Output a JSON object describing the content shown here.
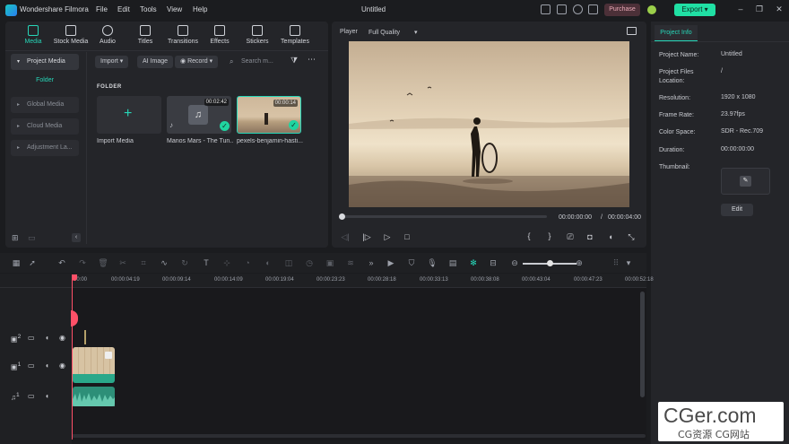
{
  "titlebar": {
    "app_name": "Wondershare Filmora",
    "menu": [
      "File",
      "Edit",
      "Tools",
      "View",
      "Help"
    ],
    "title": "Untitled",
    "purchase_label": "Purchase",
    "export_label": "Export"
  },
  "media_tabs": [
    {
      "label": "Media",
      "icon": "media-icon",
      "active": true
    },
    {
      "label": "Stock Media",
      "icon": "stock-media-icon"
    },
    {
      "label": "Audio",
      "icon": "music-note-icon"
    },
    {
      "label": "Titles",
      "icon": "text-t-icon"
    },
    {
      "label": "Transitions",
      "icon": "transition-icon"
    },
    {
      "label": "Effects",
      "icon": "sparkle-icon"
    },
    {
      "label": "Stickers",
      "icon": "sticker-icon"
    },
    {
      "label": "Templates",
      "icon": "template-icon"
    }
  ],
  "sidebar": {
    "project_media": "Project Media",
    "folder": "Folder",
    "items": [
      "Global Media",
      "Cloud Media",
      "Adjustment La..."
    ]
  },
  "media_toolbar": {
    "import": "Import",
    "ai_image": "AI Image",
    "record": "Record",
    "search_placeholder": "Search m..."
  },
  "media_grid": {
    "folder_label": "FOLDER",
    "import_label": "Import Media",
    "items": [
      {
        "name": "Manos Mars - The Tun...",
        "duration": "00:02:42"
      },
      {
        "name": "pexels-benjamin-hasti...",
        "duration": "00:00:14"
      }
    ]
  },
  "player": {
    "label": "Player",
    "quality": "Full Quality",
    "current_time": "00:00:00:00",
    "separator": "/",
    "total_time": "00:00:04:00"
  },
  "project_info": {
    "tab": "Project Info",
    "fields": [
      {
        "label": "Project Name:",
        "value": "Untitled"
      },
      {
        "label": "Project Files Location:",
        "value": "/"
      },
      {
        "label": "Resolution:",
        "value": "1920 x 1080"
      },
      {
        "label": "Frame Rate:",
        "value": "23.97fps"
      },
      {
        "label": "Color Space:",
        "value": "SDR - Rec.709"
      },
      {
        "label": "Duration:",
        "value": "00:00:00:00"
      },
      {
        "label": "Thumbnail:",
        "value": ""
      }
    ],
    "edit_label": "Edit"
  },
  "timeline": {
    "ruler": [
      "00:00",
      "00:00:04:19",
      "00:00:09:14",
      "00:00:14:09",
      "00:00:19:04",
      "00:00:23:23",
      "00:00:28:18",
      "00:00:33:13",
      "00:00:38:08",
      "00:00:43:04",
      "00:00:47:23",
      "00:00:52:18"
    ],
    "tracks": [
      "2",
      "1",
      "1"
    ]
  },
  "watermark": {
    "main": "CGer.com",
    "sub": "CG资源 CG网站"
  },
  "colors": {
    "accent": "#27d6b8",
    "export": "#20e0a4",
    "playhead": "#ff5068",
    "panel": "#242529",
    "background": "#1b1c1f"
  }
}
